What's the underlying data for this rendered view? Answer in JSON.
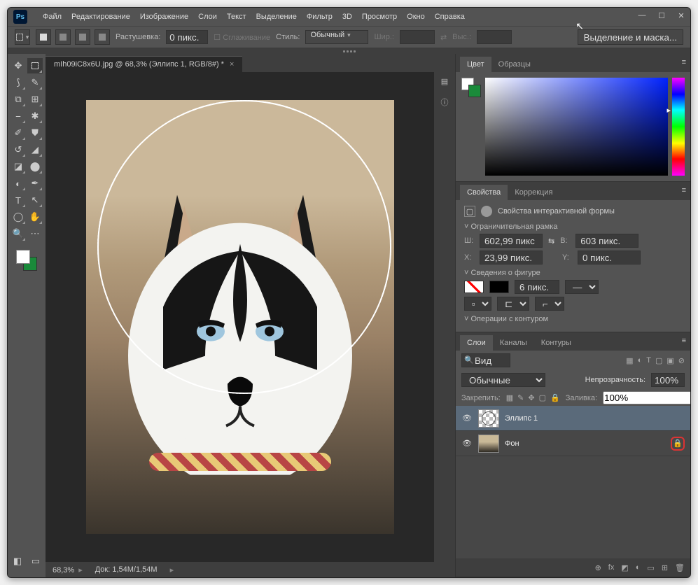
{
  "menu": {
    "items": [
      "Файл",
      "Редактирование",
      "Изображение",
      "Слои",
      "Текст",
      "Выделение",
      "Фильтр",
      "3D",
      "Просмотр",
      "Окно",
      "Справка"
    ]
  },
  "options": {
    "feather_label": "Растушевка:",
    "feather_value": "0 пикс.",
    "antialias": "Сглаживание",
    "style_label": "Стиль:",
    "style_value": "Обычный",
    "width_label": "Шир.:",
    "height_label": "Выс.:",
    "mask_btn": "Выделение и маска..."
  },
  "document": {
    "tab_title": "mIh09iC8x6U.jpg @ 68,3% (Эллипс 1, RGB/8#) *"
  },
  "status": {
    "zoom": "68,3%",
    "doc": "Док: 1,54M/1,54M"
  },
  "color_panel": {
    "tabs": [
      "Цвет",
      "Образцы"
    ],
    "active": 0
  },
  "props_panel": {
    "tabs": [
      "Свойства",
      "Коррекция"
    ],
    "active": 0,
    "title": "Свойства интерактивной формы",
    "bbox_title": "Ограничительная рамка",
    "w_label": "Ш:",
    "w_value": "602,99 пикс",
    "h_label": "В:",
    "h_value": "603 пикс.",
    "x_label": "X:",
    "x_value": "23,99 пикс.",
    "y_label": "Y:",
    "y_value": "0 пикс.",
    "shape_title": "Сведения о фигуре",
    "stroke_width": "6 пикс.",
    "ops_title": "Операции с контуром"
  },
  "layers_panel": {
    "tabs": [
      "Слои",
      "Каналы",
      "Контуры"
    ],
    "active": 0,
    "filter_label": "Вид",
    "blend_label": "Обычные",
    "opacity_label": "Непрозрачность:",
    "opacity_value": "100%",
    "lock_label": "Закрепить:",
    "fill_label": "Заливка:",
    "fill_value": "100%",
    "layers": [
      {
        "name": "Эллипс 1",
        "visible": true,
        "locked": false,
        "active": true,
        "thumb": "ellipse"
      },
      {
        "name": "Фон",
        "visible": true,
        "locked": true,
        "active": false,
        "thumb": "photo"
      }
    ]
  }
}
